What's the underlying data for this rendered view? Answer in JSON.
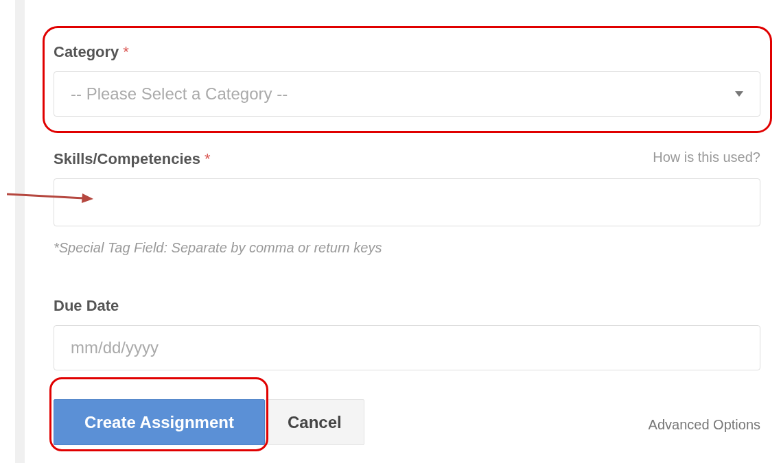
{
  "fields": [
    {
      "kind": "select",
      "label": "Category",
      "required_mark": "*",
      "placeholder": "-- Please Select a Category --"
    },
    {
      "kind": "tags",
      "label": "Skills/Competencies",
      "required_mark": "*",
      "help_link": "How is this used?",
      "hint": "*Special Tag Field: Separate by comma or return keys"
    },
    {
      "kind": "date",
      "label": "Due Date",
      "placeholder": "mm/dd/yyyy"
    }
  ],
  "buttons": [
    {
      "label": "Create Assignment",
      "kind": "primary"
    },
    {
      "label": "Cancel",
      "kind": "default"
    }
  ],
  "advanced_link": "Advanced Options"
}
